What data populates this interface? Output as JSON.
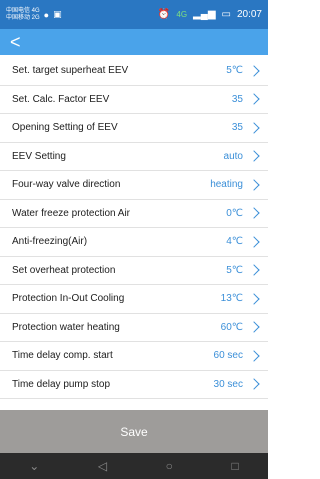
{
  "status_bar": {
    "carrier_top": "中国电信 4G",
    "carrier_bottom": "中国移动 2G",
    "network": "4G",
    "time": "20:07"
  },
  "header": {
    "back_icon": "back-arrow-icon"
  },
  "settings": [
    {
      "label": "Set. target superheat EEV",
      "value": "5℃"
    },
    {
      "label": "Set. Calc. Factor EEV",
      "value": "35"
    },
    {
      "label": "Opening Setting of EEV",
      "value": "35"
    },
    {
      "label": "EEV Setting",
      "value": "auto"
    },
    {
      "label": "Four-way valve direction",
      "value": "heating"
    },
    {
      "label": "Water freeze protection Air",
      "value": "0℃"
    },
    {
      "label": "Anti-freezing(Air)",
      "value": "4℃"
    },
    {
      "label": "Set overheat protection",
      "value": "5℃"
    },
    {
      "label": "Protection In-Out Cooling",
      "value": "13℃"
    },
    {
      "label": "Protection water heating",
      "value": "60℃"
    },
    {
      "label": "Time delay comp. start",
      "value": "60 sec"
    },
    {
      "label": "Time delay pump stop",
      "value": "30 sec"
    }
  ],
  "save_label": "Save",
  "colors": {
    "accent": "#3b8fd8",
    "header": "#4aa3ea",
    "save_bar": "#9e9c9a"
  }
}
